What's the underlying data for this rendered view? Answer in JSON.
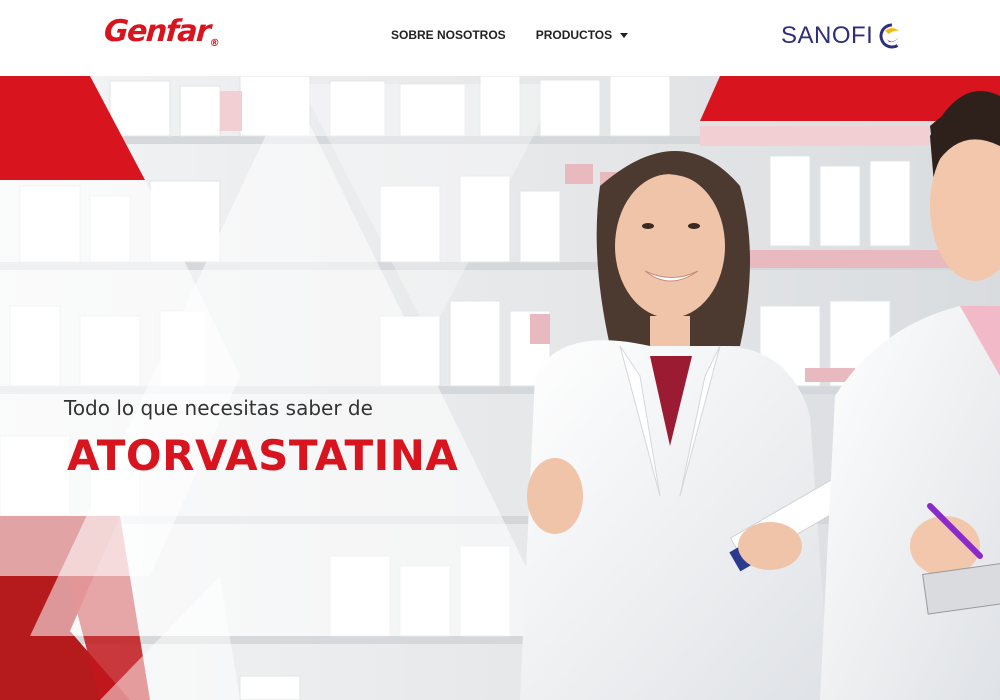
{
  "header": {
    "logo_text": "Genfar",
    "logo_reg": "®",
    "nav": [
      {
        "label": "SOBRE NOSOTROS"
      },
      {
        "label": "PRODUCTOS"
      }
    ],
    "partner_logo_text": "SANOFI"
  },
  "hero": {
    "subtitle": "Todo lo que necesitas saber de",
    "title": "ATORVASTATINA"
  },
  "colors": {
    "brand_red": "#d8141f",
    "sanofi_blue": "#2d2f7a",
    "sanofi_yellow": "#f3b716",
    "sanofi_purple": "#7a3f94"
  }
}
